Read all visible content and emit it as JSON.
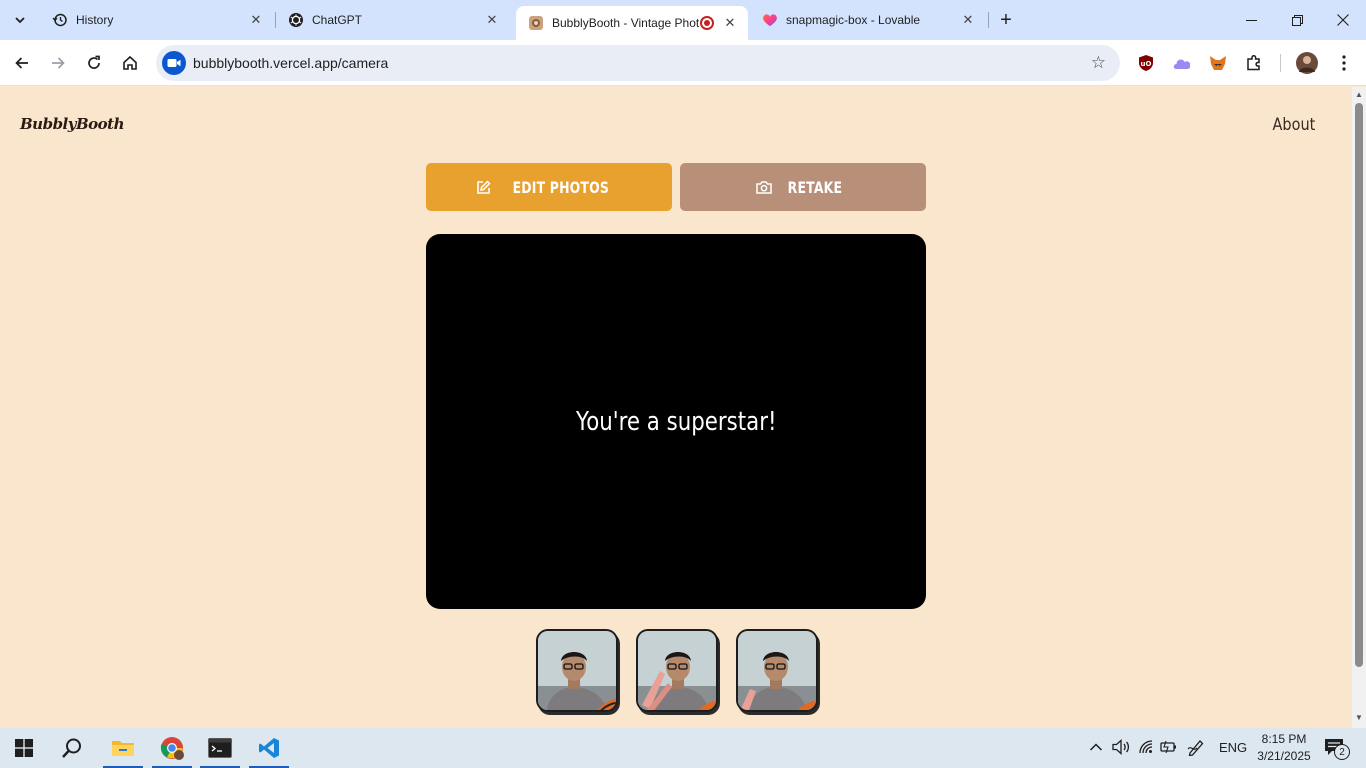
{
  "browser": {
    "tabs": [
      {
        "title": "History",
        "icon": "history-icon",
        "active": false
      },
      {
        "title": "ChatGPT",
        "icon": "chatgpt-icon",
        "active": false
      },
      {
        "title": "BubblyBooth - Vintage Phot",
        "icon": "bubblybooth-favicon",
        "active": true,
        "recording": true
      },
      {
        "title": "snapmagic-box - Lovable",
        "icon": "lovable-heart-icon",
        "active": false
      }
    ],
    "url": "bubblybooth.vercel.app/camera"
  },
  "page": {
    "logo": "BubblyBooth",
    "nav_about": "About",
    "edit_button": "EDIT PHOTOS",
    "retake_button": "RETAKE",
    "viewer_message": "You're a superstar!",
    "thumbnails": [
      {
        "name": "photo-1"
      },
      {
        "name": "photo-2"
      },
      {
        "name": "photo-3"
      }
    ],
    "colors": {
      "background": "#fae6cc",
      "edit_button": "#e8a02e",
      "retake_button": "#b8907a",
      "viewer": "#000000"
    }
  },
  "taskbar": {
    "language": "ENG",
    "time": "8:15 PM",
    "date": "3/21/2025",
    "notifications": "2"
  }
}
